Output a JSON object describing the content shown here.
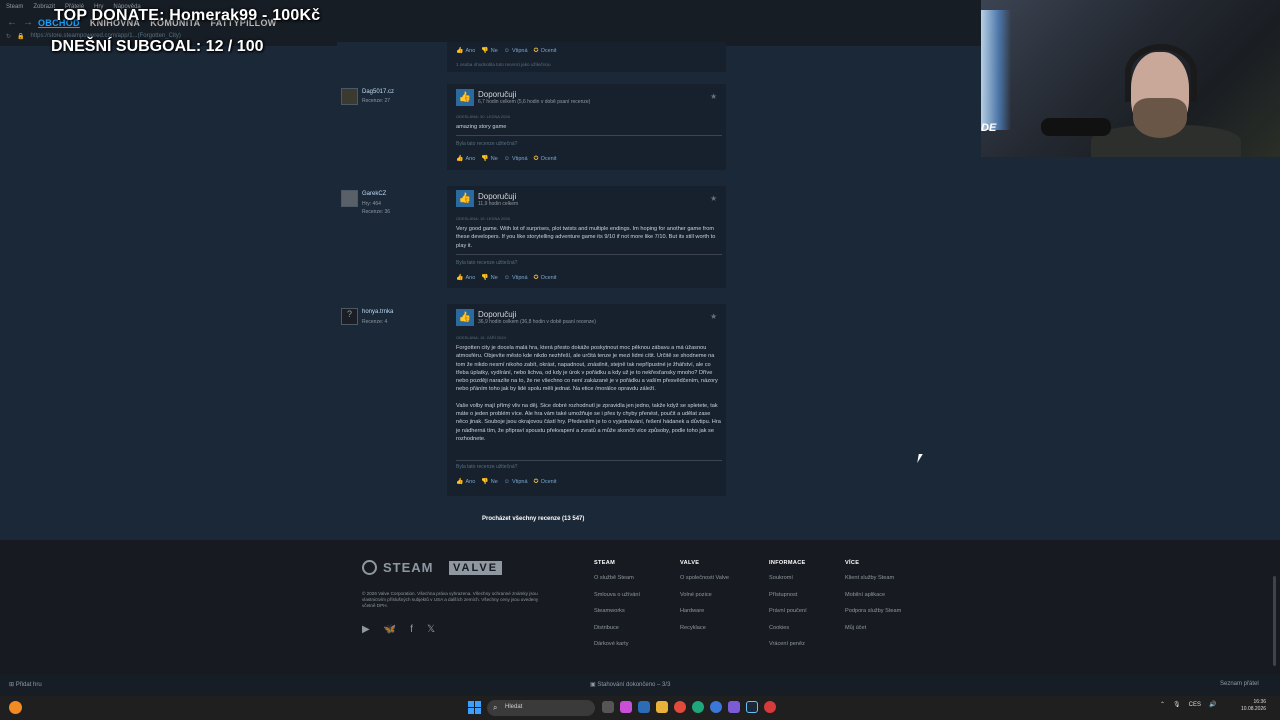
{
  "window": {
    "menu": [
      "Steam",
      "Zobrazit",
      "Přátelé",
      "Hry",
      "Nápověda"
    ],
    "tabs": [
      "OBCHOD",
      "KNIHOVNA",
      "KOMUNITA",
      "FATTYPILLOW"
    ],
    "url": "https://store.steampowered.com/app/1...(Forgotten_City)"
  },
  "overlay": {
    "donate": "TOP DONATE: Homerak99 - 100Kč",
    "subgoal": "DNEŠNÍ SUBGOAL:  12 / 100"
  },
  "webcam": {
    "logo_text": "DE"
  },
  "first_review": {
    "votes": [
      "Ano",
      "Ne",
      "Vtipná",
      "Ocenit"
    ],
    "found_helpful": "1 osoba ohodnotila tuto recenzi jako užitečnou"
  },
  "reviews": [
    {
      "user": "Dag5017.cz",
      "stats": [
        "Recenze: 27"
      ],
      "verdict": "Doporučuji",
      "hours": "6,7 hodin celkem (5,6 hodin v době psaní recenze)",
      "date": "ODESLÁNA: 30. LEDNA 2026",
      "paragraphs": [
        "amazing story game"
      ],
      "helpful_q": "Byla tato recenze užitečná?",
      "votes": [
        "Ano",
        "Ne",
        "Vtipná",
        "Ocenit"
      ]
    },
    {
      "user": "GarekCZ",
      "stats": [
        "Hry: 464",
        "Recenze: 36"
      ],
      "verdict": "Doporučuji",
      "hours": "11,9 hodin celkem",
      "date": "ODESLÁNA: 19. LEDNA 2026",
      "paragraphs": [
        "Very good game. With lot of surprises, plot twists and multiple endings. Im hoping for another game from these developers. If you like storytelling adventure game its 9/10 if not more like 7/10. But its still worth to play it."
      ],
      "helpful_q": "Byla tato recenze užitečná?",
      "votes": [
        "Ano",
        "Ne",
        "Vtipná",
        "Ocenit"
      ]
    },
    {
      "user": "honya.trnka",
      "stats": [
        "Recenze: 4"
      ],
      "verdict": "Doporučuji",
      "hours": "36,9 hodin celkem (36,8 hodin v době psaní recenze)",
      "date": "ODESLÁNA: 16. ZÁŘÍ 2024",
      "paragraphs": [
        "Forgotten city je docela malá hra, která přesto dokáže poskytnout moc pěknou zábavu a má úžasnou atmosféru. Objevíte město kde nikdo nezhřeší, ale určitá tenze je mezi lidmi cítit. Určitě se shodneme na tom že nikdo nesmí nikoho zabít, okrást, napadnout, znásilnit, stejně tak nepřípustné je žhářství, ale co třeba úplatky, vydírání, nebo lichva, od kdy je úrok v pořádku a kdy už je to nekřesťansky mnoho? Dříve nebo později narazíte na to, že ne všechno co není zakázané je v pořádku a vaším přesvědčením, názory nebo přáním toho jak by lidé spolu měli jednat. Na etice /morálce opravdu záleží.",
        "Vaše volby mají přímý vliv na děj. Sice dobré rozhodnutí je zpravidla jen jedno, takže když se spletete, tak máte o jeden problém více. Ale hra vám také umožňuje se i přes ty chyby přenést, poučit a udělat zase něco jinak. Souboje jsou okrajovou částí hry. Především je to o vyjednávání, řešení hádanek a důvtipu. Hra je nádherná tím, že připraví spoustu překvapení a zvratů a může skončit více způsoby, podle toho jak se rozhodnete."
      ],
      "helpful_q": "Byla tato recenze užitečná?",
      "votes": [
        "Ano",
        "Ne",
        "Vtipná",
        "Ocenit"
      ]
    }
  ],
  "browse_all": "Procházet všechny recenze (13 547)",
  "footer": {
    "steam": "STEAM",
    "valve": "VALVE",
    "copyright": "© 2026 Valve Corporation. Všechna práva vyhrazena. Všechny ochranné známky jsou vlastnictvím příslušných subjektů v USA a dalších zemích. Všechny ceny jsou uvedeny včetně DPH.",
    "social": [
      "youtube-icon",
      "bluesky-icon",
      "facebook-icon",
      "x-icon"
    ],
    "columns": [
      {
        "title": "STEAM",
        "links": [
          "O službě Steam",
          "Smlouva o užívání",
          "Steamworks",
          "Distribuce",
          "Dárkové karty"
        ]
      },
      {
        "title": "VALVE",
        "links": [
          "O společnosti Valve",
          "Volné pozice",
          "Hardware",
          "Recyklace"
        ]
      },
      {
        "title": "INFORMACE",
        "links": [
          "Soukromí",
          "Přístupnost",
          "Právní poučení",
          "Cookies",
          "Vrácení peněz"
        ]
      },
      {
        "title": "VÍCE",
        "links": [
          "Klient služby Steam",
          "Mobilní aplikace",
          "Podpora služby Steam",
          "Můj účet"
        ]
      }
    ]
  },
  "bottombar": {
    "add_game": "Přidat hru",
    "downloads": "Stahování dokončeno – 3/3",
    "friends": "Seznam přátel"
  },
  "taskbar": {
    "search_placeholder": "Hledat",
    "lang": "CES",
    "time": "16:36",
    "date": "10.08.2026"
  }
}
